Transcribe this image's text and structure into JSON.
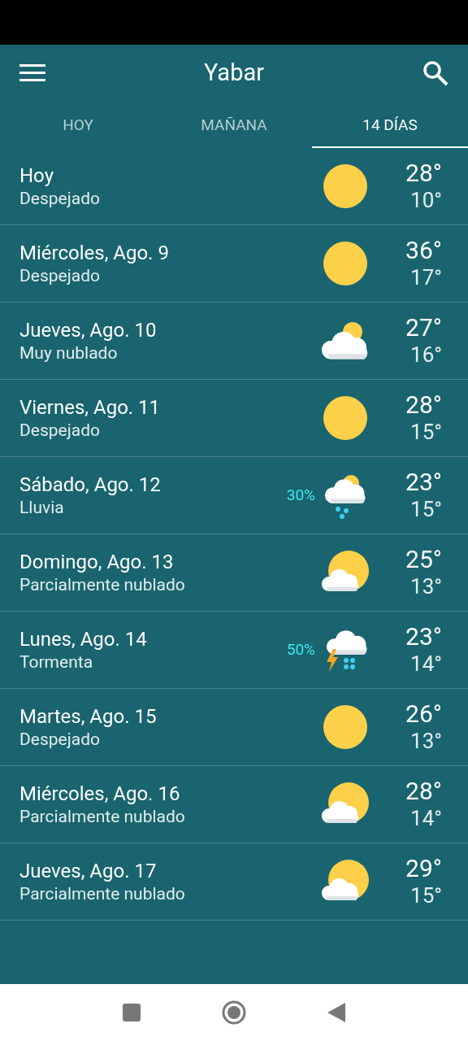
{
  "header": {
    "title": "Yabar"
  },
  "tabs": [
    {
      "label": "HOY",
      "selected": false
    },
    {
      "label": "MAÑANA",
      "selected": false
    },
    {
      "label": "14 DÍAS",
      "selected": true
    }
  ],
  "days": [
    {
      "day": "Hoy",
      "condition": "Despejado",
      "kind": "sunny",
      "high": "28°",
      "low": "10°"
    },
    {
      "day": "Miércoles, Ago. 9",
      "condition": "Despejado",
      "kind": "sunny",
      "high": "36°",
      "low": "17°"
    },
    {
      "day": "Jueves, Ago. 10",
      "condition": "Muy nublado",
      "kind": "cloudy",
      "high": "27°",
      "low": "16°"
    },
    {
      "day": "Viernes, Ago. 11",
      "condition": "Despejado",
      "kind": "sunny",
      "high": "28°",
      "low": "15°"
    },
    {
      "day": "Sábado, Ago. 12",
      "condition": "Lluvia",
      "kind": "rain",
      "precipitation": "30%",
      "high": "23°",
      "low": "15°"
    },
    {
      "day": "Domingo, Ago. 13",
      "condition": "Parcialmente nublado",
      "kind": "partly",
      "high": "25°",
      "low": "13°"
    },
    {
      "day": "Lunes, Ago. 14",
      "condition": "Tormenta",
      "kind": "storm",
      "precipitation": "50%",
      "high": "23°",
      "low": "14°"
    },
    {
      "day": "Martes, Ago. 15",
      "condition": "Despejado",
      "kind": "sunny",
      "high": "26°",
      "low": "13°"
    },
    {
      "day": "Miércoles, Ago. 16",
      "condition": "Parcialmente nublado",
      "kind": "partly",
      "high": "28°",
      "low": "14°"
    },
    {
      "day": "Jueves, Ago. 17",
      "condition": "Parcialmente nublado",
      "kind": "partly",
      "high": "29°",
      "low": "15°"
    }
  ]
}
